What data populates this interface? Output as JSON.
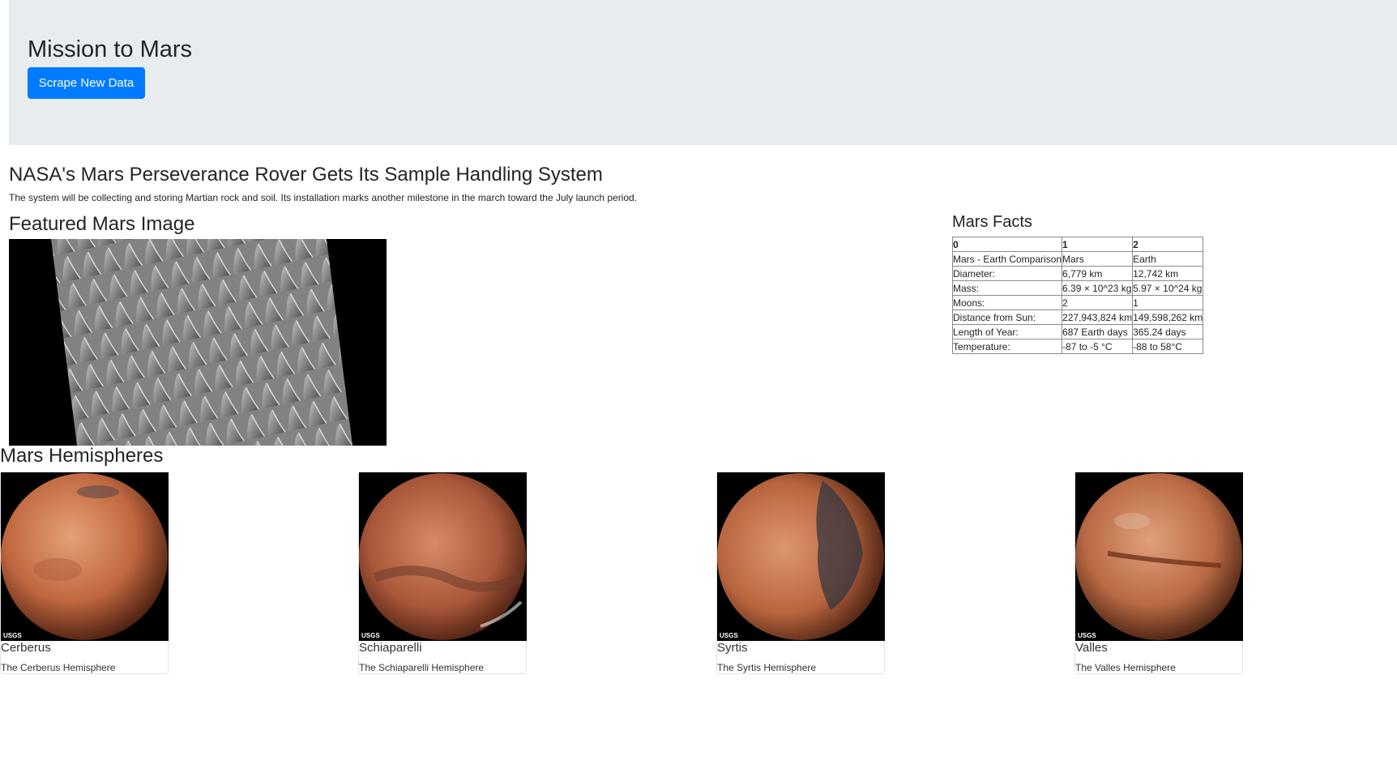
{
  "header": {
    "title": "Mission to Mars",
    "scrape_button": "Scrape New Data"
  },
  "news": {
    "title": "NASA's Mars Perseverance Rover Gets Its Sample Handling System",
    "teaser": "The system will be collecting and storing Martian rock and soil. Its installation marks another milestone in the march toward the July launch period."
  },
  "featured": {
    "title": "Featured Mars Image"
  },
  "facts": {
    "title": "Mars Facts",
    "headers": [
      "0",
      "1",
      "2"
    ],
    "rows": [
      [
        "Mars - Earth Comparison",
        "Mars",
        "Earth"
      ],
      [
        "Diameter:",
        "6,779 km",
        "12,742 km"
      ],
      [
        "Mass:",
        "6.39 × 10^23 kg",
        "5.97 × 10^24 kg"
      ],
      [
        "Moons:",
        "2",
        "1"
      ],
      [
        "Distance from Sun:",
        "227,943,824 km",
        "149,598,262 km"
      ],
      [
        "Length of Year:",
        "687 Earth days",
        "365.24 days"
      ],
      [
        "Temperature:",
        "-87 to -5 °C",
        "-88 to 58°C"
      ]
    ]
  },
  "hemispheres": {
    "title": "Mars Hemispheres",
    "logo_text": "USGS",
    "items": [
      {
        "name": "Cerberus",
        "description": "The Cerberus Hemisphere"
      },
      {
        "name": "Schiaparelli",
        "description": "The Schiaparelli Hemisphere"
      },
      {
        "name": "Syrtis",
        "description": "The Syrtis Hemisphere"
      },
      {
        "name": "Valles",
        "description": "The Valles Hemisphere"
      }
    ]
  },
  "colors": {
    "jumbotron_bg": "#e9ecef",
    "primary": "#007bff",
    "mars_orange": "#c8673f"
  }
}
